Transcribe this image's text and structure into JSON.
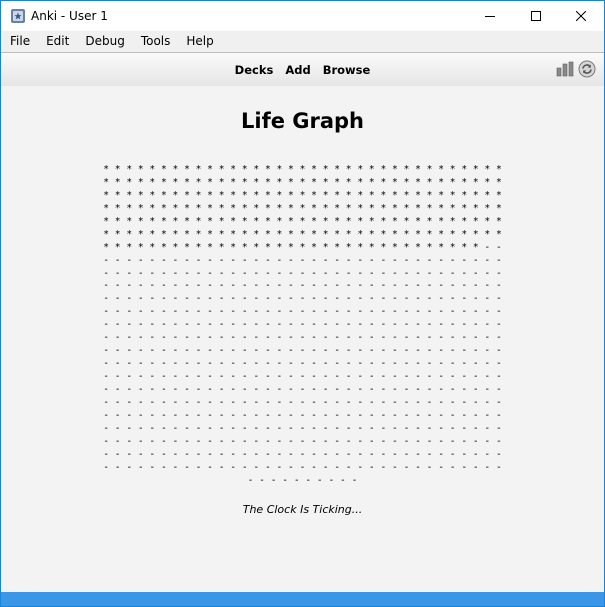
{
  "window": {
    "title": "Anki - User 1"
  },
  "menubar": {
    "items": [
      "File",
      "Edit",
      "Debug",
      "Tools",
      "Help"
    ]
  },
  "toolbar": {
    "links": [
      "Decks",
      "Add",
      "Browse"
    ],
    "right_icons": [
      "stats-icon",
      "sync-icon"
    ]
  },
  "main": {
    "title": "Life Graph",
    "graph_rows": [
      "* * * * * * * * * * * * * * * * * * * * * * * * * * * * * * * * * * *",
      "* * * * * * * * * * * * * * * * * * * * * * * * * * * * * * * * * * *",
      "* * * * * * * * * * * * * * * * * * * * * * * * * * * * * * * * * * *",
      "* * * * * * * * * * * * * * * * * * * * * * * * * * * * * * * * * * *",
      "* * * * * * * * * * * * * * * * * * * * * * * * * * * * * * * * * * *",
      "* * * * * * * * * * * * * * * * * * * * * * * * * * * * * * * * * * *",
      "* * * * * * * * * * * * * * * * * * * * * * * * * * * * * * * * * - -",
      "- - - - - - - - - - - - - - - - - - - - - - - - - - - - - - - - - - -",
      "- - - - - - - - - - - - - - - - - - - - - - - - - - - - - - - - - - -",
      "- - - - - - - - - - - - - - - - - - - - - - - - - - - - - - - - - - -",
      "- - - - - - - - - - - - - - - - - - - - - - - - - - - - - - - - - - -",
      "- - - - - - - - - - - - - - - - - - - - - - - - - - - - - - - - - - -",
      "- - - - - - - - - - - - - - - - - - - - - - - - - - - - - - - - - - -",
      "- - - - - - - - - - - - - - - - - - - - - - - - - - - - - - - - - - -",
      "- - - - - - - - - - - - - - - - - - - - - - - - - - - - - - - - - - -",
      "- - - - - - - - - - - - - - - - - - - - - - - - - - - - - - - - - - -",
      "- - - - - - - - - - - - - - - - - - - - - - - - - - - - - - - - - - -",
      "- - - - - - - - - - - - - - - - - - - - - - - - - - - - - - - - - - -",
      "- - - - - - - - - - - - - - - - - - - - - - - - - - - - - - - - - - -",
      "- - - - - - - - - - - - - - - - - - - - - - - - - - - - - - - - - - -",
      "- - - - - - - - - - - - - - - - - - - - - - - - - - - - - - - - - - -",
      "- - - - - - - - - - - - - - - - - - - - - - - - - - - - - - - - - - -",
      "- - - - - - - - - - - - - - - - - - - - - - - - - - - - - - - - - - -",
      "- - - - - - - - - - - - - - - - - - - - - - - - - - - - - - - - - - -",
      "- - - - - - - - - -"
    ],
    "subtitle": "The Clock Is Ticking..."
  },
  "colors": {
    "window_border": "#1883d7",
    "bottom_bar": "#3c96e8",
    "content_bg": "#f3f3f3"
  }
}
